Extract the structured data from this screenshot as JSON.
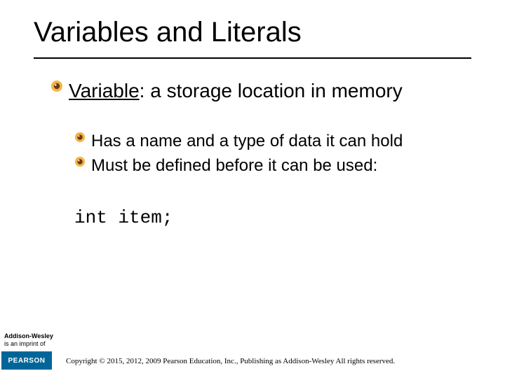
{
  "title": "Variables and Literals",
  "lvl1": {
    "term": "Variable",
    "sep": ": ",
    "definition": "a storage location in memory"
  },
  "lvl2": {
    "a": "Has a name and a type of data it can hold",
    "b": "Must be defined before it can be used:"
  },
  "code": "int item;",
  "footer": {
    "aw_line1": "Addison-Wesley",
    "aw_line2": "is an imprint of",
    "pearson": "PEARSON",
    "copyright": "Copyright © 2015, 2012, 2009 Pearson Education, Inc., Publishing as Addison-Wesley All rights reserved."
  }
}
